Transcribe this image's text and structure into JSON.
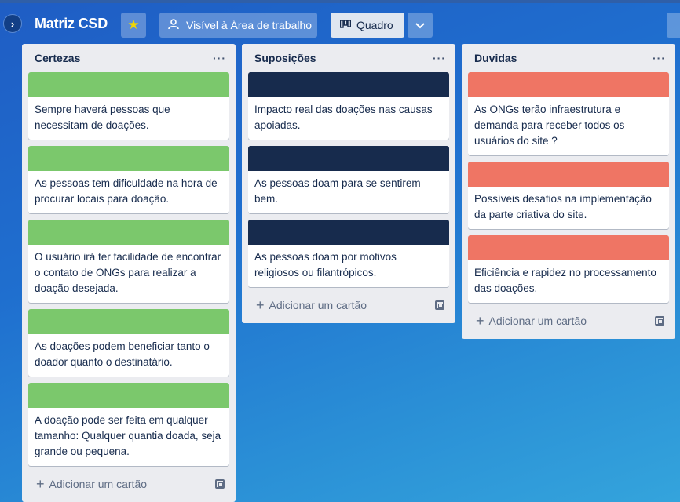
{
  "header": {
    "toggle_glyph": "›",
    "board_title": "Matriz CSD",
    "star_glyph": "★",
    "visibility_label": "Visível à Área de trabalho",
    "view_label": "Quadro",
    "dropdown_glyph": "⌄"
  },
  "colors": {
    "green": "#7bc86c",
    "navy": "#172b4d",
    "salmon": "#ef7564"
  },
  "lists": [
    {
      "title": "Certezas",
      "menu": "···",
      "add_label": "Adicionar um cartão",
      "cards": [
        {
          "cover": "#7bc86c",
          "text": "Sempre haverá pessoas que necessitam de doações."
        },
        {
          "cover": "#7bc86c",
          "text": "As pessoas tem dificuldade na hora de procurar locais para doação."
        },
        {
          "cover": "#7bc86c",
          "text": "O usuário irá ter facilidade de encontrar o contato de ONGs para realizar a doação desejada."
        },
        {
          "cover": "#7bc86c",
          "text": "As doações podem beneficiar tanto o doador quanto o destinatário."
        },
        {
          "cover": "#7bc86c",
          "text": "A doação pode ser feita em qualquer tamanho: Qualquer quantia doada, seja grande ou pequena."
        }
      ]
    },
    {
      "title": "Suposições",
      "menu": "···",
      "add_label": "Adicionar um cartão",
      "cards": [
        {
          "cover": "#172b4d",
          "text": "Impacto real das doações nas causas apoiadas."
        },
        {
          "cover": "#172b4d",
          "text": "As pessoas doam para se sentirem bem."
        },
        {
          "cover": "#172b4d",
          "text": "As pessoas doam por motivos religiosos ou filantrópicos."
        }
      ]
    },
    {
      "title": "Duvidas",
      "menu": "···",
      "add_label": "Adicionar um cartão",
      "cards": [
        {
          "cover": "#ef7564",
          "text": "As ONGs terão infraestrutura e demanda para receber todos os usuários do site ?"
        },
        {
          "cover": "#ef7564",
          "text": "Possíveis desafios na implementação da parte criativa do site."
        },
        {
          "cover": "#ef7564",
          "text": "Eficiência e rapidez no processamento das doações."
        }
      ]
    }
  ]
}
